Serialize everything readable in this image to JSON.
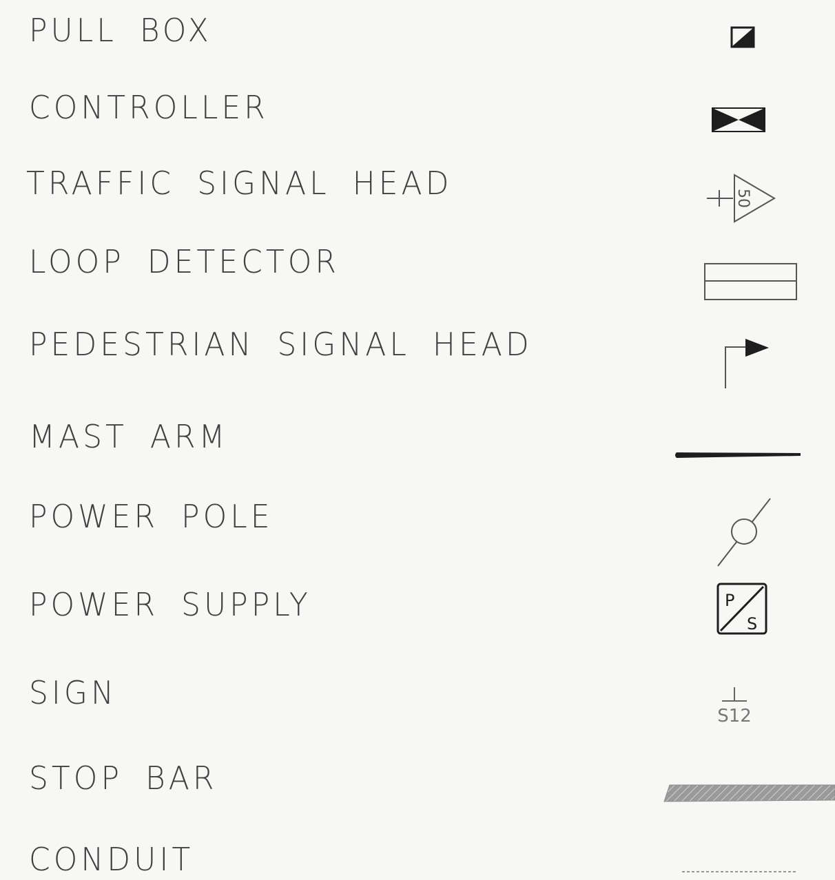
{
  "legend": {
    "items": [
      {
        "label": "PULL BOX",
        "symbol": "pull-box-icon"
      },
      {
        "label": "CONTROLLER",
        "symbol": "controller-icon"
      },
      {
        "label": "TRAFFIC SIGNAL HEAD",
        "symbol": "traffic-signal-head-icon",
        "symbol_text": "50"
      },
      {
        "label": "LOOP DETECTOR",
        "symbol": "loop-detector-icon"
      },
      {
        "label": "PEDESTRIAN SIGNAL HEAD",
        "symbol": "pedestrian-signal-head-icon"
      },
      {
        "label": "MAST ARM",
        "symbol": "mast-arm-icon"
      },
      {
        "label": "POWER POLE",
        "symbol": "power-pole-icon"
      },
      {
        "label": "POWER SUPPLY",
        "symbol": "power-supply-icon",
        "symbol_text_top": "P",
        "symbol_text_bottom": "S"
      },
      {
        "label": "SIGN",
        "symbol": "sign-icon",
        "symbol_text": "S12"
      },
      {
        "label": "STOP BAR",
        "symbol": "stop-bar-icon"
      },
      {
        "label": "CONDUIT",
        "symbol": "conduit-icon"
      }
    ]
  },
  "colors": {
    "background": "#f7f7f5",
    "ink": "#404040",
    "symbol": "#1e1e1e"
  }
}
